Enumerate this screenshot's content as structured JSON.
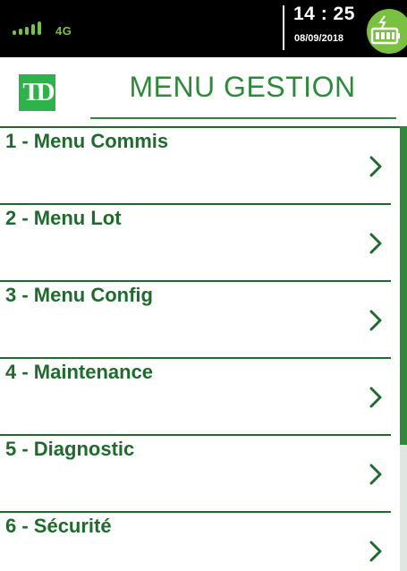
{
  "status_bar": {
    "signal_icon": "signal-bars-icon",
    "network": "4G",
    "time": "14 : 25",
    "date": "08/09/2018",
    "battery_icon": "battery-charging-icon"
  },
  "header": {
    "logo_text": "TD",
    "title": "MENU GESTION"
  },
  "menu": {
    "items": [
      {
        "label": "1 - Menu Commis",
        "icon": "chevron-right-icon"
      },
      {
        "label": "2 - Menu Lot",
        "icon": "chevron-right-icon"
      },
      {
        "label": "3 - Menu Config",
        "icon": "chevron-right-icon"
      },
      {
        "label": "4 - Maintenance",
        "icon": "chevron-right-icon"
      },
      {
        "label": "5 - Diagnostic",
        "icon": "chevron-right-icon"
      },
      {
        "label": "6 - Sécurité",
        "icon": "chevron-right-icon"
      }
    ]
  },
  "scroll": {
    "position_fraction": 0
  },
  "colors": {
    "brand_green": "#2db34a",
    "title_green": "#2d8a3a",
    "label_green": "#1f6b2d",
    "status_green": "#7ac142",
    "status_bg": "#000000"
  }
}
